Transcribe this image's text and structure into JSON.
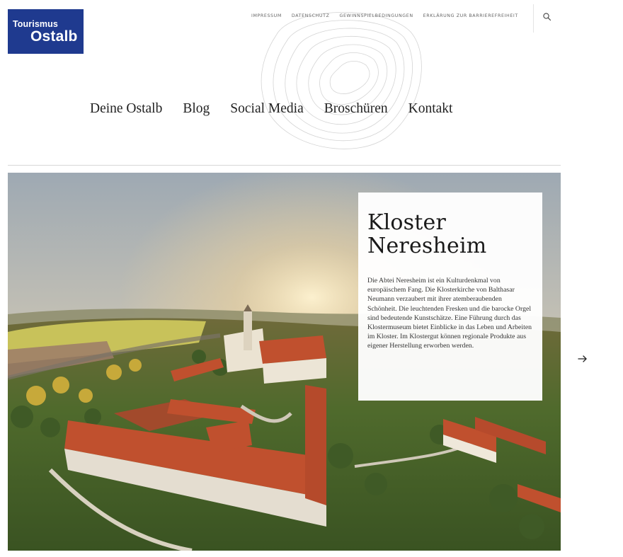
{
  "logo": {
    "line1": "Tourismus",
    "line2": "Ostalb"
  },
  "top_links": [
    {
      "label": "Impressum"
    },
    {
      "label": "Datenschutz"
    },
    {
      "label": "Gewinnspielbedingungen"
    },
    {
      "label": "Erklärung zur Barrierefreiheit"
    }
  ],
  "search": {
    "icon": "search-icon"
  },
  "nav": [
    {
      "label": "Deine Ostalb"
    },
    {
      "label": "Blog"
    },
    {
      "label": "Social Media"
    },
    {
      "label": "Broschüren"
    },
    {
      "label": "Kontakt"
    }
  ],
  "hero": {
    "title_line1": "Kloster",
    "title_line2": "Neresheim",
    "description": "Die Abtei Neresheim ist ein Kulturdenkmal von europäischem Fang. Die Klosterkirche von Balthasar Neumann verzaubert mit ihrer atemberaubenden Schönheit. Die leuchtenden Fresken und die barocke Orgel sind bedeutende Kunstschätze. Eine Führung durch das Klostermuseum bietet Einblicke in das Leben und Arbeiten im Kloster. Im Klostergut können regionale Produkte aus eigener Herstellung erworben werden.",
    "next_icon": "arrow-right-icon"
  },
  "colors": {
    "brand": "#1f3a8f",
    "roof": "#c0502e"
  }
}
